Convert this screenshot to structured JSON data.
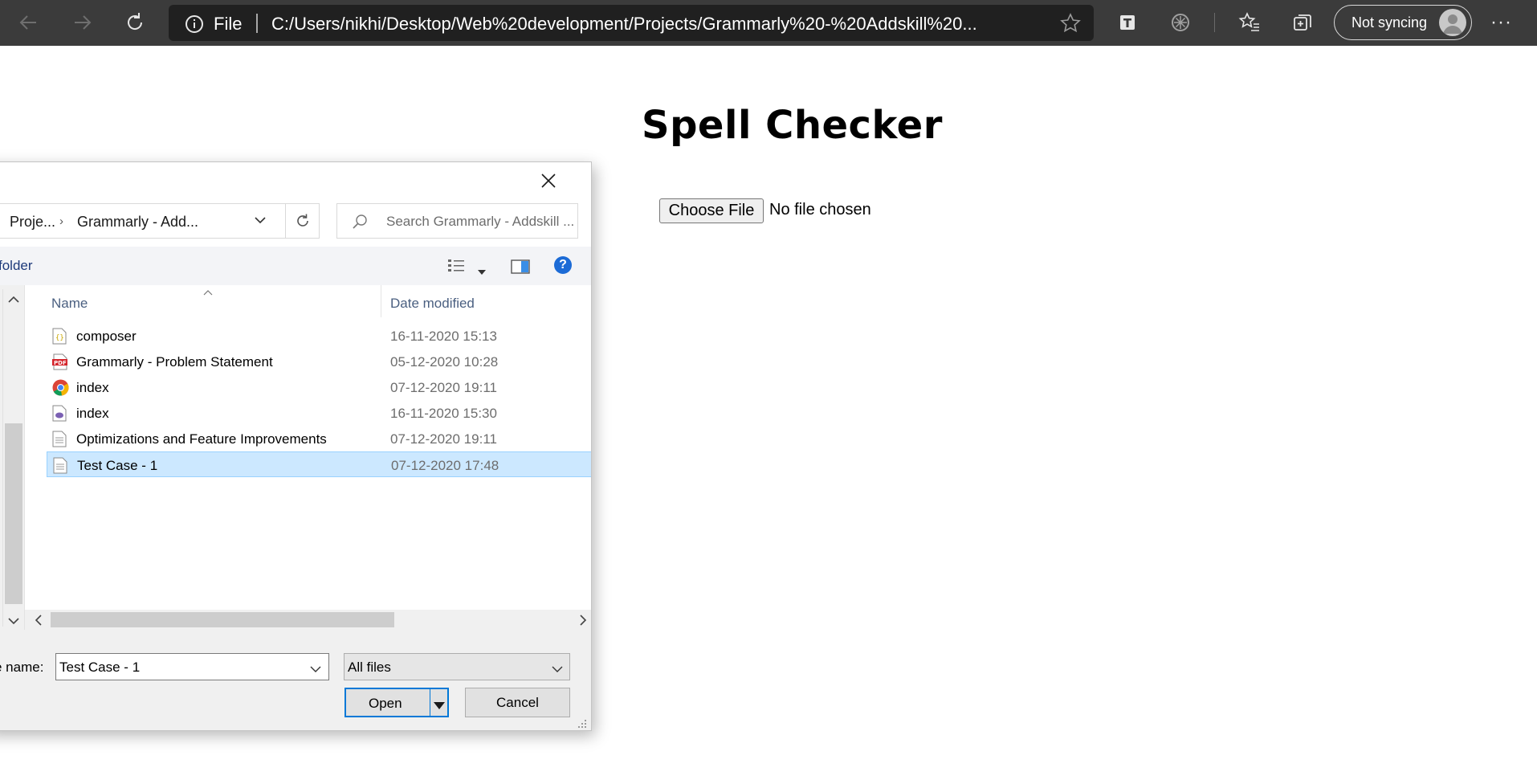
{
  "browser": {
    "address": {
      "scheme": "File",
      "url": "C:/Users/nikhi/Desktop/Web%20development/Projects/Grammarly%20-%20Addskill%20..."
    },
    "profile": {
      "sync_label": "Not syncing"
    },
    "more_label": "···"
  },
  "page": {
    "title": "Spell Checker",
    "file_input": {
      "button_label": "Choose File",
      "status": "No file chosen"
    }
  },
  "dialog": {
    "breadcrumb": {
      "parent": "Proje...",
      "current": "Grammarly - Add..."
    },
    "search_placeholder": "Search Grammarly - Addskill ...",
    "new_folder_label": "folder",
    "columns": {
      "name": "Name",
      "date_modified": "Date modified"
    },
    "files": [
      {
        "name": "composer",
        "date": "16-11-2020 15:13",
        "icon": "json-file-icon"
      },
      {
        "name": "Grammarly - Problem Statement",
        "date": "05-12-2020 10:28",
        "icon": "pdf-file-icon"
      },
      {
        "name": "index",
        "date": "07-12-2020 19:11",
        "icon": "chrome-html-file-icon"
      },
      {
        "name": "index",
        "date": "16-11-2020 15:30",
        "icon": "php-file-icon"
      },
      {
        "name": "Optimizations and Feature Improvements",
        "date": "07-12-2020 19:11",
        "icon": "text-file-icon"
      },
      {
        "name": "Test Case - 1",
        "date": "07-12-2020 17:48",
        "icon": "text-file-icon",
        "selected": true
      }
    ],
    "file_name_label": "e name:",
    "file_name_value": "Test Case - 1",
    "file_type": "All files",
    "open_label": "Open",
    "cancel_label": "Cancel"
  },
  "colors": {
    "toolbar_bg": "#3b3b3b",
    "address_bg": "#202020",
    "selection_bg": "#cce8ff",
    "selection_border": "#99d1ff",
    "accent_blue": "#0078d7"
  }
}
